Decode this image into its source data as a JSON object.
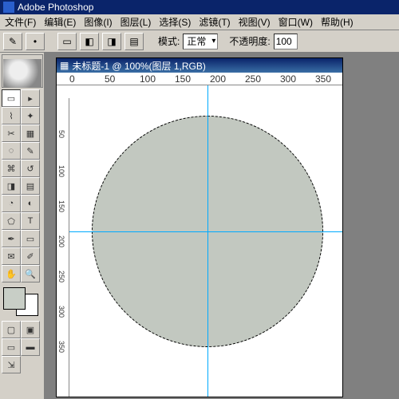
{
  "app": {
    "title": "Adobe Photoshop"
  },
  "menu": {
    "file": "文件(F)",
    "edit": "编辑(E)",
    "image": "图像(I)",
    "layer": "图层(L)",
    "select": "选择(S)",
    "filter": "滤镜(T)",
    "view": "视图(V)",
    "window": "窗口(W)",
    "help": "帮助(H)"
  },
  "options": {
    "mode_label": "模式:",
    "mode_value": "正常",
    "opacity_label": "不透明度:",
    "opacity_value": "100"
  },
  "document": {
    "title": "未标题-1 @ 100%(图层 1,RGB)",
    "ruler_h": [
      "0",
      "50",
      "100",
      "150",
      "200",
      "250",
      "300",
      "350"
    ],
    "ruler_v": [
      "50",
      "100",
      "150",
      "200",
      "250",
      "300",
      "350"
    ]
  },
  "tools": {
    "marquee": "▭",
    "move": "▸",
    "lasso": "⌇",
    "wand": "✦",
    "crop": "✂",
    "slice": "▦",
    "heal": "◌",
    "brush": "✎",
    "stamp": "⌘",
    "history": "↺",
    "eraser": "◨",
    "gradient": "▤",
    "blur": "◔",
    "dodge": "◐",
    "path": "⬠",
    "type": "T",
    "pen": "✒",
    "shape": "▭",
    "notes": "✉",
    "eyedrop": "✐",
    "hand": "✋",
    "zoom": "🔍"
  },
  "colors": {
    "fg": "#c8cec6",
    "bg": "#ffffff"
  }
}
